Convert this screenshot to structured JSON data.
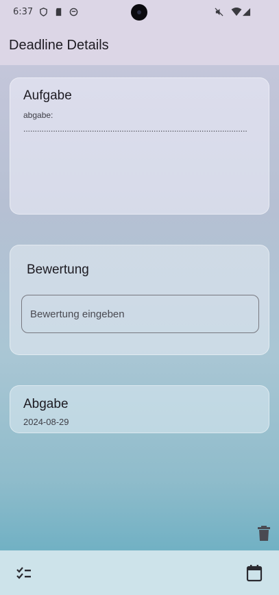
{
  "status_bar": {
    "time": "6:37",
    "left_icons": [
      "shield-icon",
      "sd-card-icon",
      "face-icon"
    ],
    "right_icons": [
      "mute-icon",
      "wifi-icon",
      "signal-icon"
    ]
  },
  "app_bar": {
    "title": "Deadline Details"
  },
  "task_card": {
    "title": "Aufgabe",
    "body": "abgabe: .................................................................................................."
  },
  "rating_card": {
    "title": "Bewertung",
    "input_placeholder": "Bewertung eingeben",
    "input_value": ""
  },
  "due_card": {
    "title": "Abgabe",
    "date": "2024-08-29"
  },
  "actions": {
    "delete_icon": "delete-icon"
  },
  "bottom_nav": {
    "items": [
      {
        "icon": "checklist-icon"
      },
      {
        "icon": "calendar-icon"
      }
    ]
  },
  "colors": {
    "app_bar": "#dcd6e6",
    "bottom_nav": "#cde3ea",
    "gradient_bottom": "#72b1c4"
  }
}
